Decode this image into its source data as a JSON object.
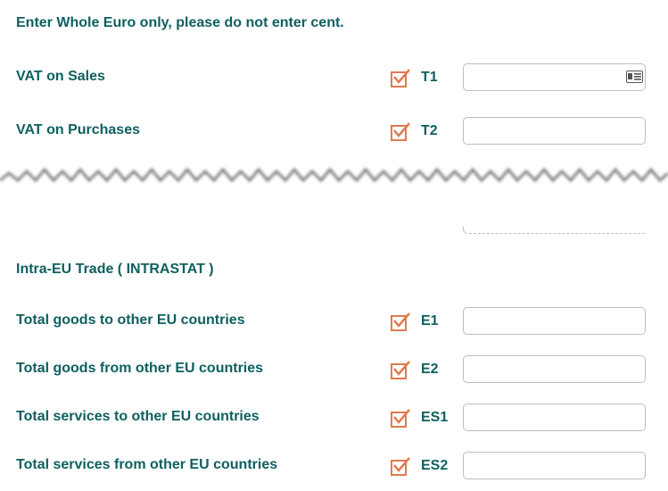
{
  "instruction": "Enter Whole Euro only, please do not enter cent.",
  "vat_rows": [
    {
      "label": "VAT on Sales",
      "code": "T1",
      "value": "",
      "checked": true
    },
    {
      "label": "VAT on Purchases",
      "code": "T2",
      "value": "",
      "checked": true
    }
  ],
  "section_title": "Intra-EU Trade ( INTRASTAT )",
  "eu_rows": [
    {
      "label": "Total goods to other EU countries",
      "code": "E1",
      "value": "",
      "checked": true
    },
    {
      "label": "Total goods from other EU countries",
      "code": "E2",
      "value": "",
      "checked": true
    },
    {
      "label": "Total services to other EU countries",
      "code": "ES1",
      "value": "",
      "checked": true
    },
    {
      "label": "Total services from other EU countries",
      "code": "ES2",
      "value": "",
      "checked": true
    }
  ],
  "icons": {
    "autofill": "contact-card-icon",
    "check": "checkmark-icon"
  },
  "colors": {
    "label": "#0f5f5f",
    "checkbox": "#e07a4e",
    "field_border": "#b9bec3"
  }
}
